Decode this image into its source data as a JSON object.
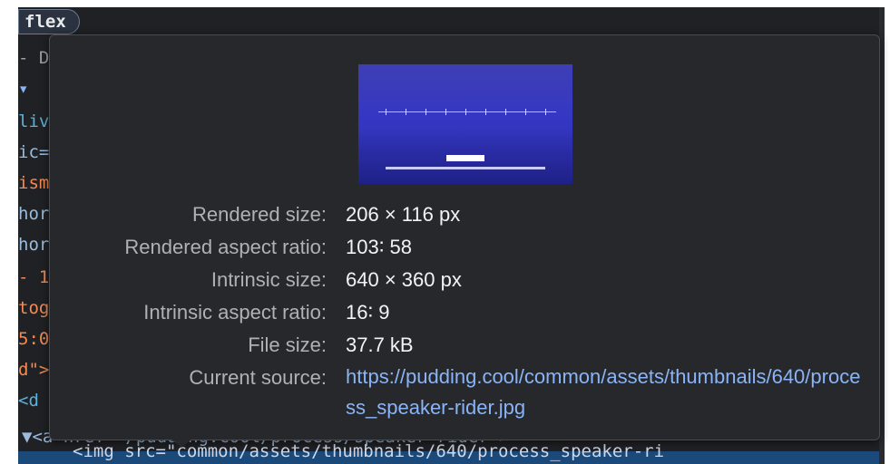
{
  "code_bg": {
    "badge": "flex",
    "lines": [
      {
        "text": "- D",
        "color": "#9aa0a6"
      },
      {
        "text": "▾",
        "color": "#8ab4f8"
      },
      {
        "text": "liv",
        "color": "#5db0d7"
      },
      {
        "text": "ic=",
        "color": "#9bbbdc"
      },
      {
        "text": "ism",
        "color": "#f28b54"
      },
      {
        "text": "hor",
        "color": "#9bbbdc"
      },
      {
        "text": "hor",
        "color": "#9bbbdc"
      },
      {
        "text": "- 1",
        "color": "#f28b54"
      },
      {
        "text": "tog",
        "color": "#f28b54"
      },
      {
        "text": "5:0",
        "color": "#f28b54"
      },
      {
        "text": "d\">",
        "color": "#f28b54"
      },
      {
        "text": "<d",
        "color": "#5db0d7"
      }
    ],
    "row_under_tooltip": "▼<a href=\"/pudding.cool/process/speaker-rider\">",
    "selected_row": "<img src=\"common/assets/thumbnails/640/process_speaker-ri"
  },
  "tooltip": {
    "properties": [
      {
        "label": "Rendered size:",
        "value": "206 × 116 px"
      },
      {
        "label": "Rendered aspect ratio:",
        "value": "103∶ 58"
      },
      {
        "label": "Intrinsic size:",
        "value": "640 × 360 px"
      },
      {
        "label": "Intrinsic aspect ratio:",
        "value": "16∶ 9"
      },
      {
        "label": "File size:",
        "value": "37.7 kB"
      }
    ],
    "current_source": {
      "label": "Current source:",
      "url": "https://pudding.cool/common/assets/thumbnails/640/process_speaker-rider.jpg"
    }
  },
  "colors": {
    "panel_bg": "#202124",
    "tooltip_bg": "#27282b",
    "label": "#aeb1b6",
    "value": "#f1f3f4",
    "link": "#8ab4f8",
    "preview_accent": "#3537c4"
  }
}
